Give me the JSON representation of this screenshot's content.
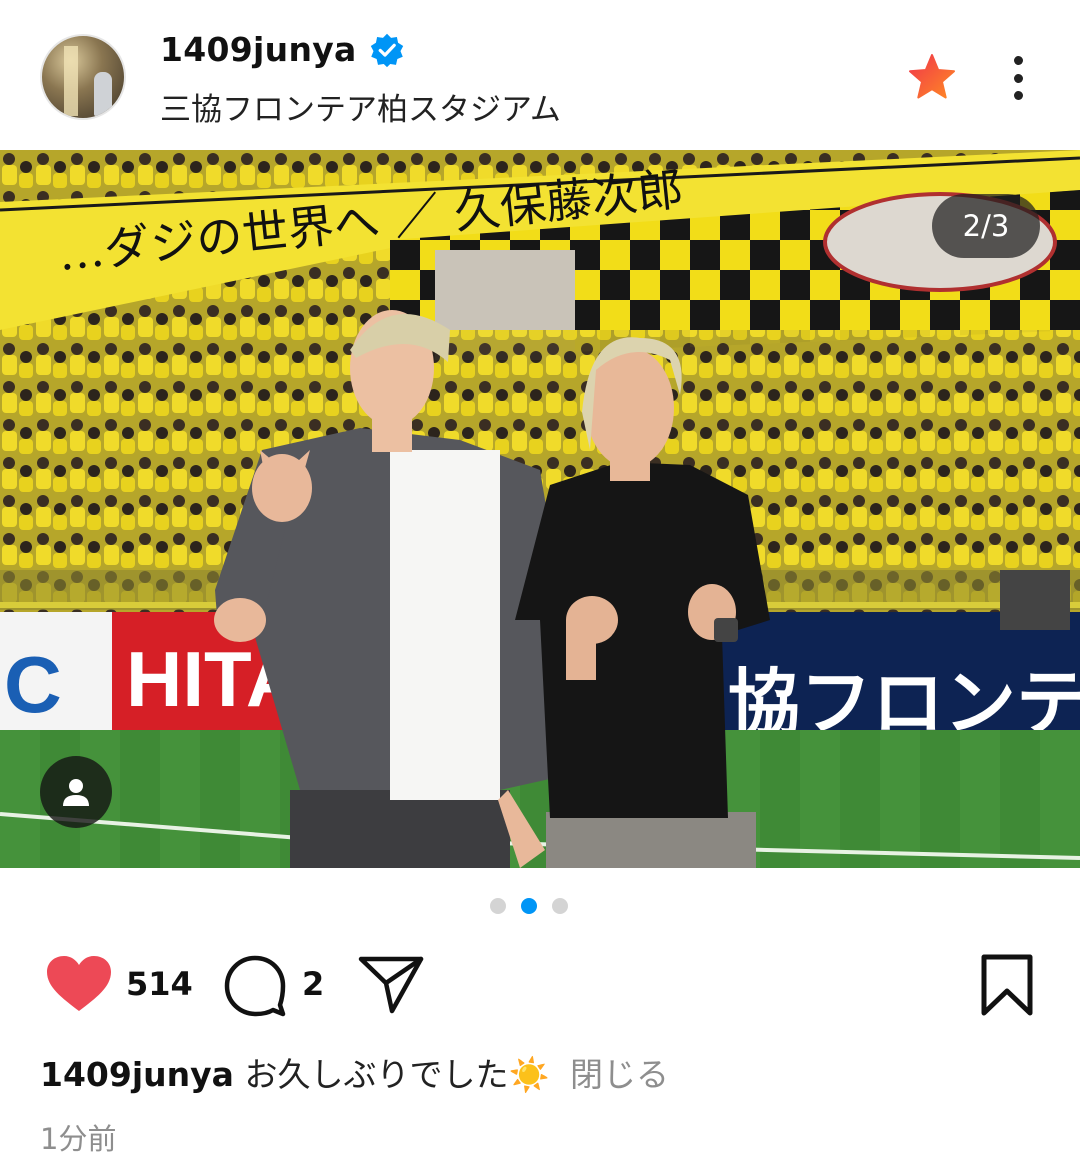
{
  "post": {
    "username": "1409junya",
    "location": "三協フロンテア柏スタジアム",
    "counter": "2/3",
    "banner_text": "…ダジの世界へ ／ 久保藤次郎",
    "ad_board_left": "HITA",
    "ad_board_right": "協フロンテ",
    "likes": "514",
    "comments": "2",
    "caption_user": "1409junya",
    "caption_text": "お久しぶりでした",
    "caption_emoji": "☀️",
    "caption_close": "閉じる",
    "time_ago": "1分前"
  },
  "carousel": {
    "total": 3,
    "active_index": 1
  },
  "icons": {
    "verified": "verified-badge-icon",
    "favorite": "star-icon",
    "more": "more-options-icon",
    "tag": "person-icon",
    "like": "heart-icon",
    "comment": "comment-icon",
    "share": "paper-plane-icon",
    "save": "bookmark-icon"
  },
  "colors": {
    "verified_blue": "#0095f6",
    "heart_red": "#ed4956",
    "star_red": "#f0354b",
    "star_orange": "#ff8a24",
    "dot_active": "#0095f6",
    "muted_text": "#8e8e8e"
  }
}
